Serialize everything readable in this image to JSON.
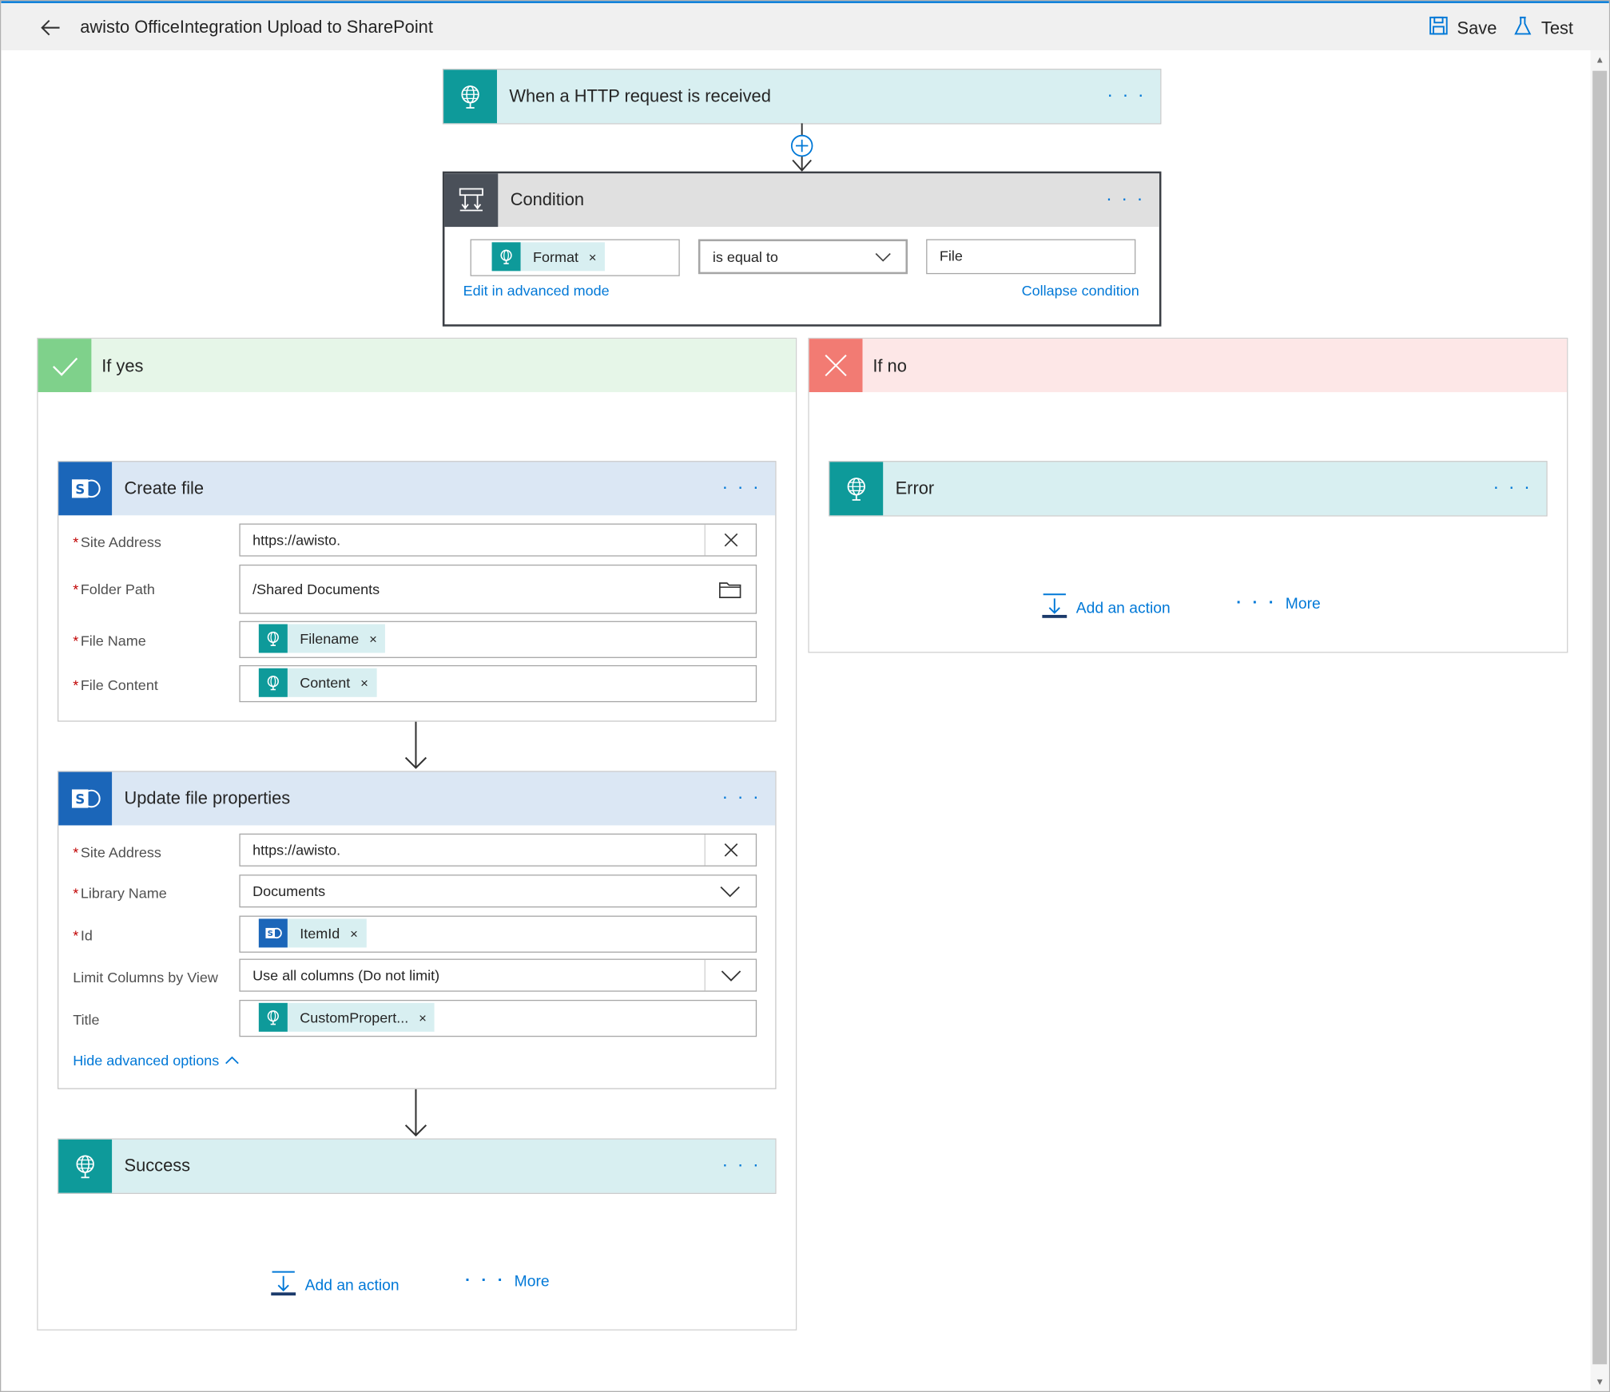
{
  "header": {
    "title": "awisto OfficeIntegration Upload to SharePoint",
    "save_label": "Save",
    "test_label": "Test"
  },
  "trigger": {
    "title": "When a HTTP request is received"
  },
  "condition": {
    "title": "Condition",
    "left_token": "Format",
    "operator": "is equal to",
    "value": "File",
    "edit_advanced": "Edit in advanced mode",
    "collapse": "Collapse condition"
  },
  "if_yes": {
    "title": "If yes",
    "create_file": {
      "title": "Create file",
      "site_address_label": "Site Address",
      "site_address_value": "https://awisto.",
      "folder_path_label": "Folder Path",
      "folder_path_value": "/Shared Documents",
      "file_name_label": "File Name",
      "file_name_token": "Filename",
      "file_content_label": "File Content",
      "file_content_token": "Content"
    },
    "update_props": {
      "title": "Update file properties",
      "site_address_label": "Site Address",
      "site_address_value": "https://awisto.",
      "library_name_label": "Library Name",
      "library_name_value": "Documents",
      "id_label": "Id",
      "id_token": "ItemId",
      "limit_columns_label": "Limit Columns by View",
      "limit_columns_value": "Use all columns (Do not limit)",
      "title_label": "Title",
      "title_token": "CustomPropert...",
      "hide_advanced": "Hide advanced options"
    },
    "success": {
      "title": "Success"
    },
    "add_action": "Add an action",
    "more": "More"
  },
  "if_no": {
    "title": "If no",
    "error": {
      "title": "Error"
    },
    "add_action": "Add an action",
    "more": "More"
  },
  "colors": {
    "accent": "#0078d7",
    "teal": "#0e9a9a",
    "sharepoint_blue": "#1b66b9",
    "yes_green": "#7fd18b",
    "no_red": "#f27b73"
  },
  "dots": "· · ·",
  "required_mark": "*",
  "remove_mark": "×"
}
